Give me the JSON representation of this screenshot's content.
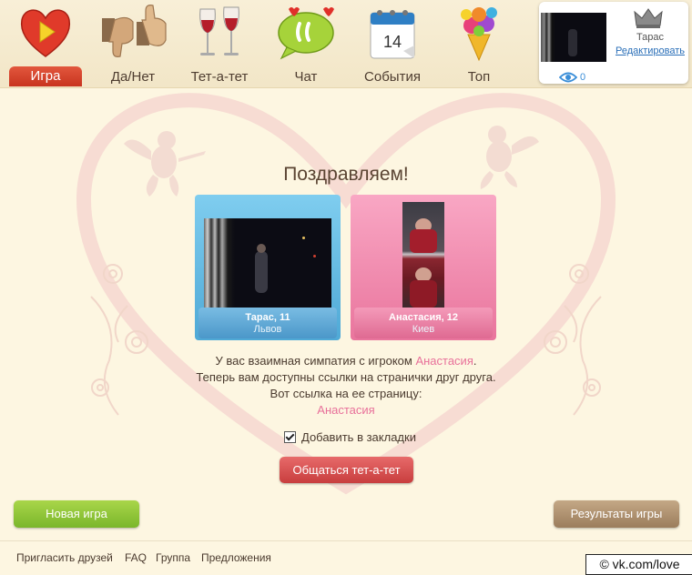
{
  "nav": {
    "tabs": [
      {
        "label": "Игра",
        "icon": "heart-play-icon",
        "active": true
      },
      {
        "label": "Да/Нет",
        "icon": "thumbs-icon"
      },
      {
        "label": "Тет-а-тет",
        "icon": "wine-glasses-icon"
      },
      {
        "label": "Чат",
        "icon": "chat-bubble-icon"
      },
      {
        "label": "События",
        "icon": "calendar-icon",
        "calendar_day": "14"
      },
      {
        "label": "Топ",
        "icon": "bouquet-icon"
      }
    ]
  },
  "profile": {
    "name": "Тарас",
    "edit_label": "Редактировать",
    "views": "0"
  },
  "main": {
    "title": "Поздравляем!",
    "my_card": {
      "name": "Тарас, 11",
      "city": "Львов"
    },
    "match_card": {
      "name": "Анастасия, 12",
      "city": "Киев"
    },
    "line1_prefix": "У вас взаимная симпатия с игроком ",
    "line1_name": "Анастасия",
    "line1_suffix": ".",
    "line2": "Теперь вам доступны ссылки на странички друг друга.",
    "line3": "Вот ссылка на ее страницу:",
    "profile_link": "Анастасия",
    "bookmark_label": "Добавить в закладки",
    "bookmark_checked": true,
    "chat_button": "Общаться тет-а-тет"
  },
  "buttons": {
    "new_game": "Новая игра",
    "results": "Результаты игры"
  },
  "footer": {
    "links": [
      "Пригласить друзей",
      "FAQ",
      "Группа",
      "Предложения"
    ]
  },
  "watermark": "© vk.com/love",
  "colors": {
    "active_tab": "#d4432b",
    "accent_pink": "#e8709a",
    "link_blue": "#2a6fb8",
    "chat_button": "#c83e3e",
    "new_game_button": "#8cc43a",
    "results_button": "#a88a68"
  }
}
